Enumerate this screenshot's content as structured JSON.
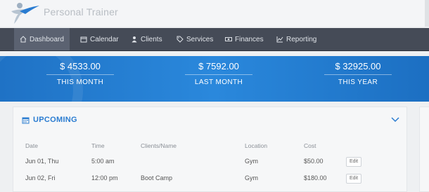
{
  "app": {
    "title": "Personal Trainer"
  },
  "nav": {
    "items": [
      {
        "label": "Dashboard",
        "icon": "home-icon",
        "active": true
      },
      {
        "label": "Calendar",
        "icon": "calendar-icon"
      },
      {
        "label": "Clients",
        "icon": "user-icon"
      },
      {
        "label": "Services",
        "icon": "tag-icon"
      },
      {
        "label": "Finances",
        "icon": "money-icon"
      },
      {
        "label": "Reporting",
        "icon": "line-chart-icon"
      }
    ]
  },
  "stats": [
    {
      "value": "$ 4533.00",
      "label": "THIS MONTH"
    },
    {
      "value": "$ 7592.00",
      "label": "LAST MONTH"
    },
    {
      "value": "$ 32925.00",
      "label": "THIS YEAR"
    }
  ],
  "upcoming": {
    "title": "UPCOMING",
    "columns": [
      "Date",
      "Time",
      "Clients/Name",
      "Location",
      "Cost"
    ],
    "rows": [
      {
        "date": "Jun 01, Thu",
        "time": "5:00 am",
        "client": "",
        "location": "Gym",
        "cost": "$50.00",
        "action": "Edit"
      },
      {
        "date": "Jun 02, Fri",
        "time": "12:00 pm",
        "client": "Boot Camp",
        "location": "Gym",
        "cost": "$180.00",
        "action": "Edit"
      }
    ]
  },
  "colors": {
    "accent": "#2a7cd1",
    "navbar": "#454b57",
    "band": "#2a88dc"
  }
}
